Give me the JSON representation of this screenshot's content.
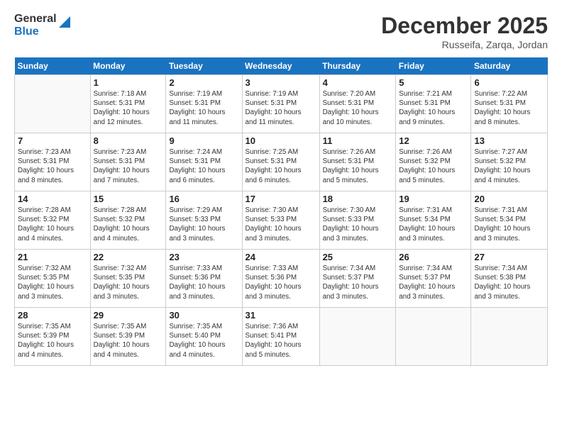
{
  "header": {
    "logo_line1": "General",
    "logo_line2": "Blue",
    "month_title": "December 2025",
    "location": "Russeifa, Zarqa, Jordan"
  },
  "weekdays": [
    "Sunday",
    "Monday",
    "Tuesday",
    "Wednesday",
    "Thursday",
    "Friday",
    "Saturday"
  ],
  "weeks": [
    [
      {
        "num": "",
        "info": ""
      },
      {
        "num": "1",
        "info": "Sunrise: 7:18 AM\nSunset: 5:31 PM\nDaylight: 10 hours\nand 12 minutes."
      },
      {
        "num": "2",
        "info": "Sunrise: 7:19 AM\nSunset: 5:31 PM\nDaylight: 10 hours\nand 11 minutes."
      },
      {
        "num": "3",
        "info": "Sunrise: 7:19 AM\nSunset: 5:31 PM\nDaylight: 10 hours\nand 11 minutes."
      },
      {
        "num": "4",
        "info": "Sunrise: 7:20 AM\nSunset: 5:31 PM\nDaylight: 10 hours\nand 10 minutes."
      },
      {
        "num": "5",
        "info": "Sunrise: 7:21 AM\nSunset: 5:31 PM\nDaylight: 10 hours\nand 9 minutes."
      },
      {
        "num": "6",
        "info": "Sunrise: 7:22 AM\nSunset: 5:31 PM\nDaylight: 10 hours\nand 8 minutes."
      }
    ],
    [
      {
        "num": "7",
        "info": "Sunrise: 7:23 AM\nSunset: 5:31 PM\nDaylight: 10 hours\nand 8 minutes."
      },
      {
        "num": "8",
        "info": "Sunrise: 7:23 AM\nSunset: 5:31 PM\nDaylight: 10 hours\nand 7 minutes."
      },
      {
        "num": "9",
        "info": "Sunrise: 7:24 AM\nSunset: 5:31 PM\nDaylight: 10 hours\nand 6 minutes."
      },
      {
        "num": "10",
        "info": "Sunrise: 7:25 AM\nSunset: 5:31 PM\nDaylight: 10 hours\nand 6 minutes."
      },
      {
        "num": "11",
        "info": "Sunrise: 7:26 AM\nSunset: 5:31 PM\nDaylight: 10 hours\nand 5 minutes."
      },
      {
        "num": "12",
        "info": "Sunrise: 7:26 AM\nSunset: 5:32 PM\nDaylight: 10 hours\nand 5 minutes."
      },
      {
        "num": "13",
        "info": "Sunrise: 7:27 AM\nSunset: 5:32 PM\nDaylight: 10 hours\nand 4 minutes."
      }
    ],
    [
      {
        "num": "14",
        "info": "Sunrise: 7:28 AM\nSunset: 5:32 PM\nDaylight: 10 hours\nand 4 minutes."
      },
      {
        "num": "15",
        "info": "Sunrise: 7:28 AM\nSunset: 5:32 PM\nDaylight: 10 hours\nand 4 minutes."
      },
      {
        "num": "16",
        "info": "Sunrise: 7:29 AM\nSunset: 5:33 PM\nDaylight: 10 hours\nand 3 minutes."
      },
      {
        "num": "17",
        "info": "Sunrise: 7:30 AM\nSunset: 5:33 PM\nDaylight: 10 hours\nand 3 minutes."
      },
      {
        "num": "18",
        "info": "Sunrise: 7:30 AM\nSunset: 5:33 PM\nDaylight: 10 hours\nand 3 minutes."
      },
      {
        "num": "19",
        "info": "Sunrise: 7:31 AM\nSunset: 5:34 PM\nDaylight: 10 hours\nand 3 minutes."
      },
      {
        "num": "20",
        "info": "Sunrise: 7:31 AM\nSunset: 5:34 PM\nDaylight: 10 hours\nand 3 minutes."
      }
    ],
    [
      {
        "num": "21",
        "info": "Sunrise: 7:32 AM\nSunset: 5:35 PM\nDaylight: 10 hours\nand 3 minutes."
      },
      {
        "num": "22",
        "info": "Sunrise: 7:32 AM\nSunset: 5:35 PM\nDaylight: 10 hours\nand 3 minutes."
      },
      {
        "num": "23",
        "info": "Sunrise: 7:33 AM\nSunset: 5:36 PM\nDaylight: 10 hours\nand 3 minutes."
      },
      {
        "num": "24",
        "info": "Sunrise: 7:33 AM\nSunset: 5:36 PM\nDaylight: 10 hours\nand 3 minutes."
      },
      {
        "num": "25",
        "info": "Sunrise: 7:34 AM\nSunset: 5:37 PM\nDaylight: 10 hours\nand 3 minutes."
      },
      {
        "num": "26",
        "info": "Sunrise: 7:34 AM\nSunset: 5:37 PM\nDaylight: 10 hours\nand 3 minutes."
      },
      {
        "num": "27",
        "info": "Sunrise: 7:34 AM\nSunset: 5:38 PM\nDaylight: 10 hours\nand 3 minutes."
      }
    ],
    [
      {
        "num": "28",
        "info": "Sunrise: 7:35 AM\nSunset: 5:39 PM\nDaylight: 10 hours\nand 4 minutes."
      },
      {
        "num": "29",
        "info": "Sunrise: 7:35 AM\nSunset: 5:39 PM\nDaylight: 10 hours\nand 4 minutes."
      },
      {
        "num": "30",
        "info": "Sunrise: 7:35 AM\nSunset: 5:40 PM\nDaylight: 10 hours\nand 4 minutes."
      },
      {
        "num": "31",
        "info": "Sunrise: 7:36 AM\nSunset: 5:41 PM\nDaylight: 10 hours\nand 5 minutes."
      },
      {
        "num": "",
        "info": ""
      },
      {
        "num": "",
        "info": ""
      },
      {
        "num": "",
        "info": ""
      }
    ]
  ]
}
